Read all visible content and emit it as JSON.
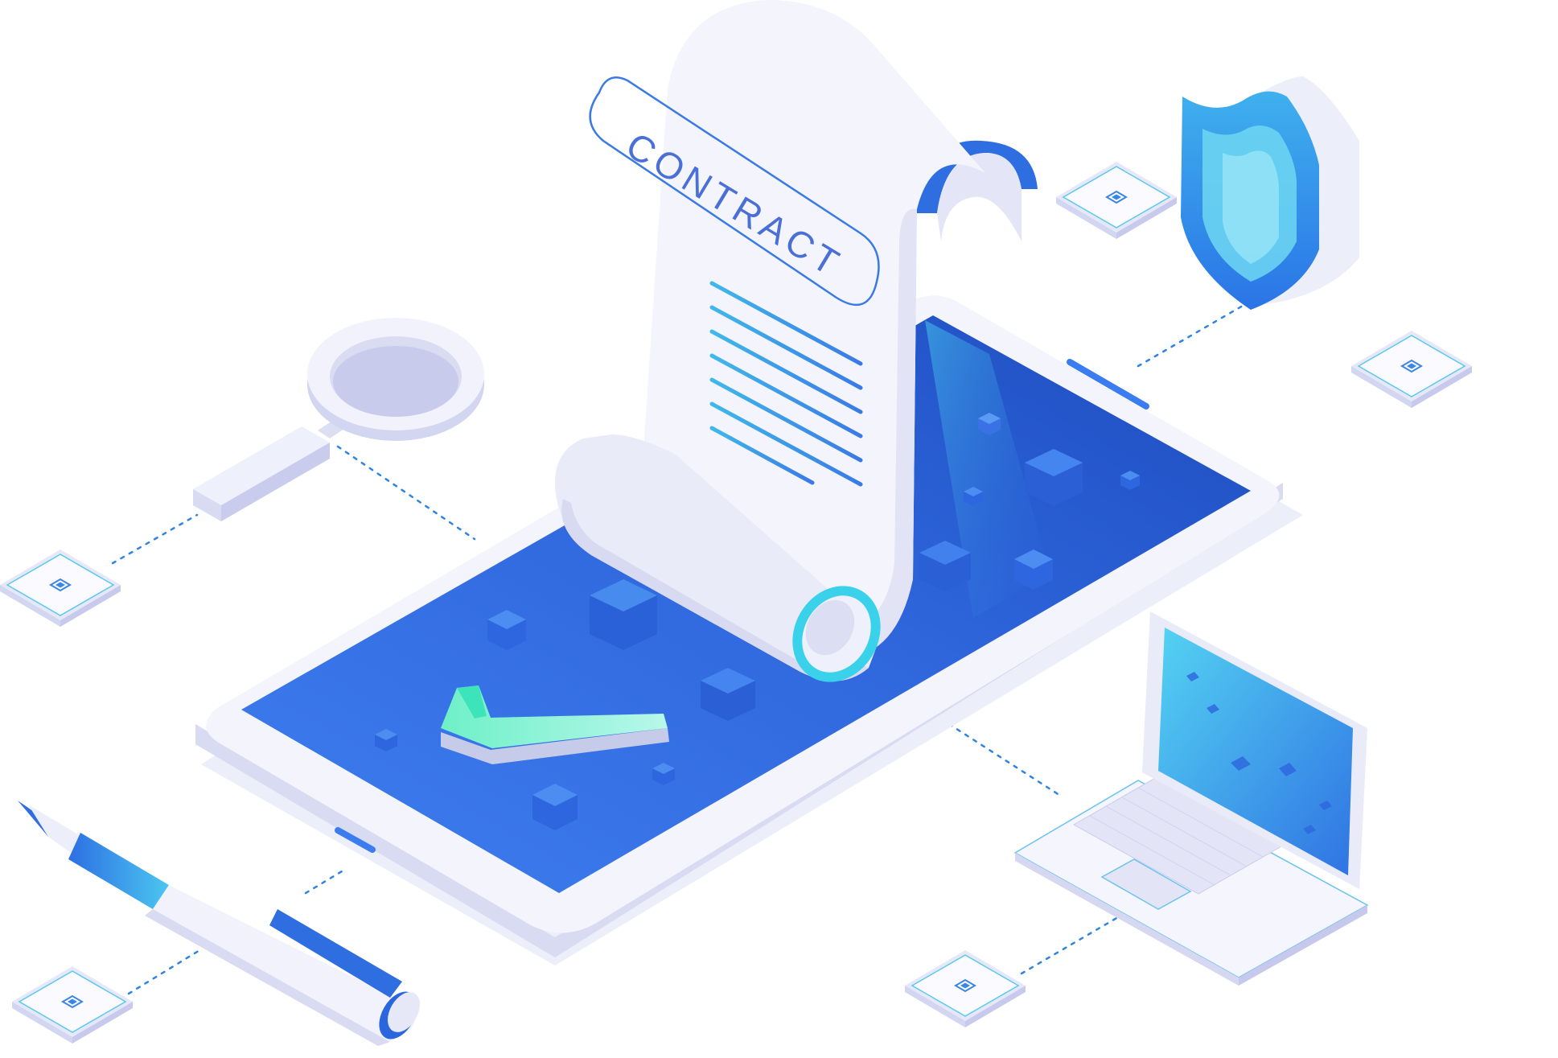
{
  "illustration": {
    "contract_label": "CONTRACT"
  },
  "colors": {
    "background": "#ffffff",
    "blue_dark": "#1f4fc4",
    "blue_mid": "#3b7cf0",
    "blue_light": "#5fd0f2",
    "teal": "#4fd9d8",
    "paper": "#f1f2fb",
    "paper_shadow": "#d9dbf2",
    "connector": "#2f84e0"
  },
  "icons": [
    "contract-scroll",
    "smartphone",
    "magnifier-icon",
    "shield-icon",
    "laptop",
    "pen",
    "checkmark-icon",
    "chip-node"
  ]
}
